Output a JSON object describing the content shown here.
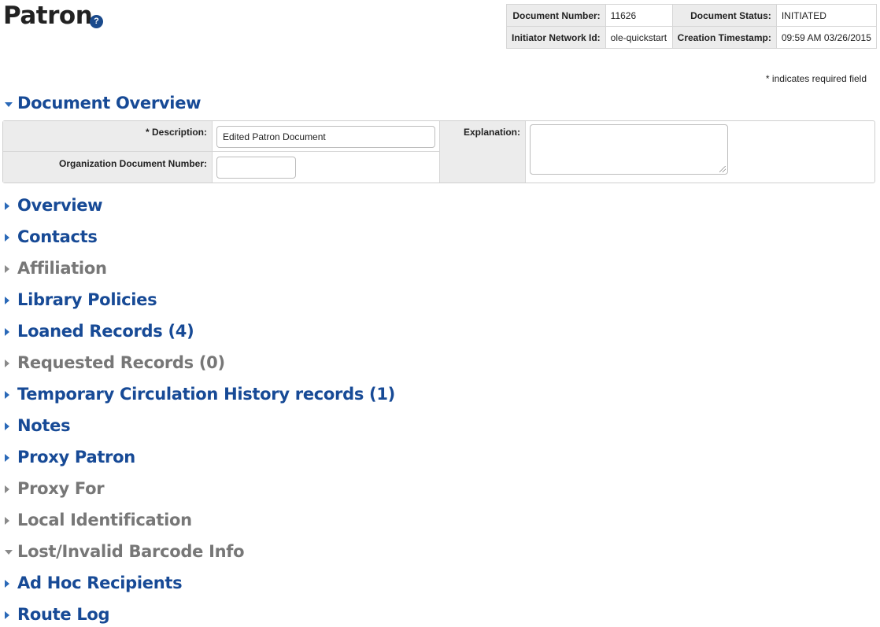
{
  "page": {
    "title": "Patron",
    "help": "?"
  },
  "header_info": {
    "document_number_label": "Document Number:",
    "document_number": "11626",
    "document_status_label": "Document Status:",
    "document_status": "INITIATED",
    "initiator_label": "Initiator Network Id:",
    "initiator": "ole-quickstart",
    "creation_label": "Creation Timestamp:",
    "creation": "09:59 AM 03/26/2015"
  },
  "required_note": "* indicates required field",
  "document_overview": {
    "title": "Document Overview",
    "description_label": "* Description:",
    "description_value": "Edited Patron Document",
    "org_doc_number_label": "Organization Document Number:",
    "org_doc_number_value": "",
    "explanation_label": "Explanation:",
    "explanation_value": ""
  },
  "sections": [
    {
      "title": "Overview",
      "state": "active",
      "expanded": false
    },
    {
      "title": "Contacts",
      "state": "active",
      "expanded": false
    },
    {
      "title": "Affiliation",
      "state": "disabled",
      "expanded": false
    },
    {
      "title": "Library Policies",
      "state": "active",
      "expanded": false
    },
    {
      "title": "Loaned Records (4)",
      "state": "active",
      "expanded": false
    },
    {
      "title": "Requested Records (0)",
      "state": "disabled",
      "expanded": false
    },
    {
      "title": "Temporary Circulation History records (1)",
      "state": "active",
      "expanded": false
    },
    {
      "title": "Notes",
      "state": "active",
      "expanded": false
    },
    {
      "title": "Proxy Patron",
      "state": "active",
      "expanded": false
    },
    {
      "title": "Proxy For",
      "state": "disabled",
      "expanded": false
    },
    {
      "title": "Local Identification",
      "state": "disabled",
      "expanded": false
    },
    {
      "title": "Lost/Invalid Barcode Info",
      "state": "disabled",
      "expanded": true
    },
    {
      "title": "Ad Hoc Recipients",
      "state": "active",
      "expanded": false
    },
    {
      "title": "Route Log",
      "state": "active",
      "expanded": false
    }
  ]
}
